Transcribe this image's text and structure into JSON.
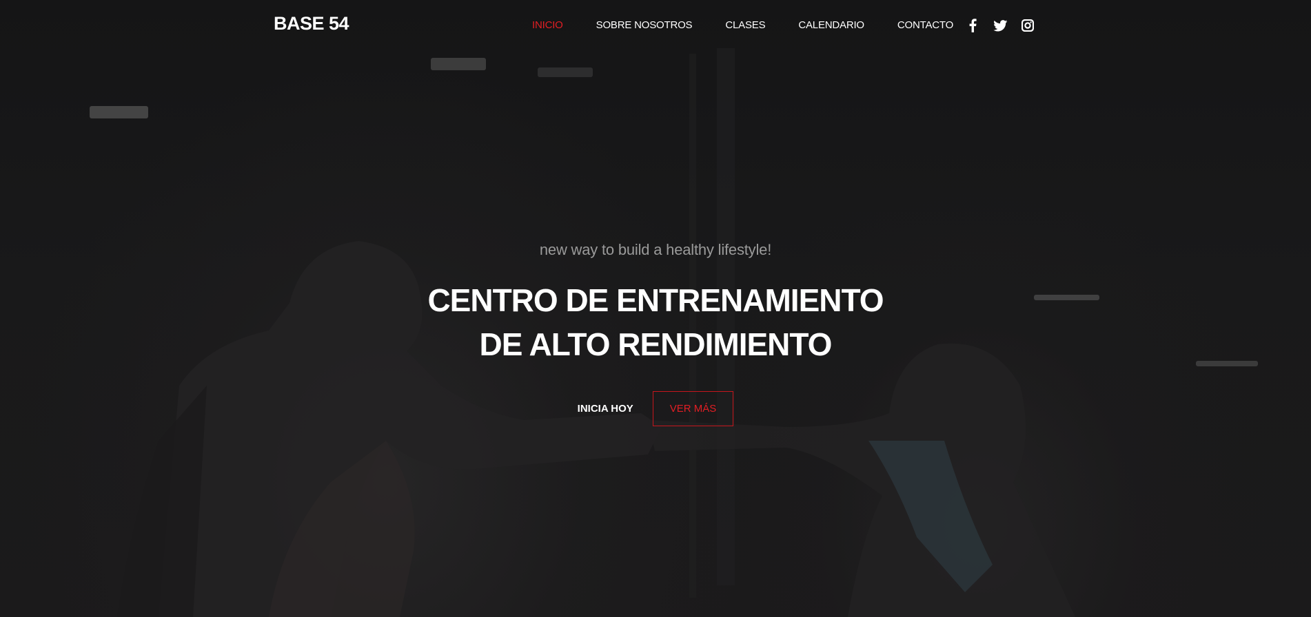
{
  "brand": {
    "logo": "BASE 54"
  },
  "nav": {
    "items": [
      {
        "label": "INICIO",
        "active": true
      },
      {
        "label": "SOBRE NOSOTROS",
        "active": false
      },
      {
        "label": "CLASES",
        "active": false
      },
      {
        "label": "CALENDARIO",
        "active": false
      },
      {
        "label": "CONTACTO",
        "active": false
      }
    ],
    "social": [
      {
        "icon": "facebook-icon"
      },
      {
        "icon": "twitter-icon"
      },
      {
        "icon": "instagram-icon"
      }
    ]
  },
  "hero": {
    "tagline": "new way to build a healthy lifestyle!",
    "headline_line1": "CENTRO DE ENTRENAMIENTO",
    "headline_line2": "DE ALTO RENDIMIENTO",
    "primary_cta": "INICIA HOY",
    "secondary_cta": "VER MÁS"
  },
  "colors": {
    "accent": "#e31e24",
    "background": "#161617",
    "text": "#ffffff",
    "muted": "#9a9a9a"
  }
}
